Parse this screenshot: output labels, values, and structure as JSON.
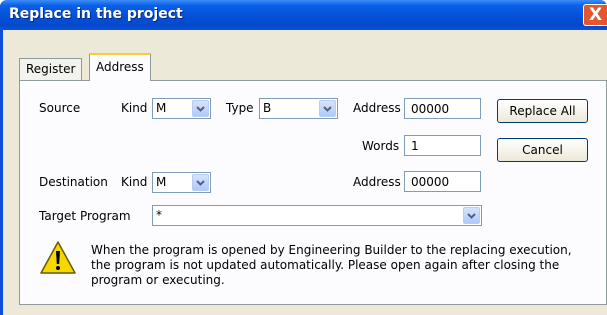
{
  "window": {
    "title": "Replace in the project",
    "close_glyph": "X"
  },
  "tabs": [
    {
      "label": "Register",
      "active": false
    },
    {
      "label": "Address",
      "active": true
    }
  ],
  "source": {
    "label": "Source",
    "kind_label": "Kind",
    "kind_value": "M",
    "type_label": "Type",
    "type_value": "B",
    "address_label": "Address",
    "address_value": "00000",
    "words_label": "Words",
    "words_value": "1"
  },
  "destination": {
    "label": "Destination",
    "kind_label": "Kind",
    "kind_value": "M",
    "address_label": "Address",
    "address_value": "00000"
  },
  "target_program": {
    "label": "Target Program",
    "value": "*"
  },
  "buttons": {
    "replace_all": "Replace All",
    "cancel": "Cancel"
  },
  "message": {
    "icon": "warning-icon",
    "lines": [
      "When the program is opened by Engineering Builder to the replacing execution,",
      "the program is not updated automatically. Please open again after closing the",
      "program or executing."
    ]
  },
  "colors": {
    "titlebar": "#0552d8",
    "dialog_bg": "#ece9d8",
    "panel_bg": "#fcfcfe",
    "close_button": "#e2572e",
    "active_tab_accent": "#ffc83c"
  }
}
